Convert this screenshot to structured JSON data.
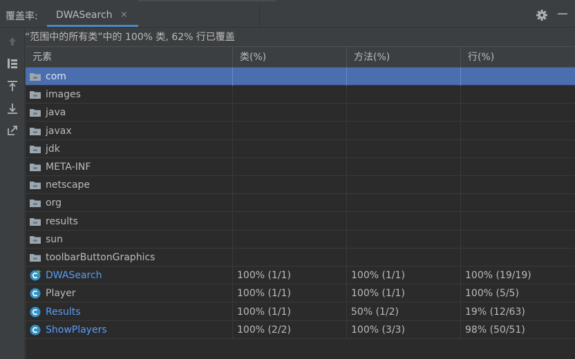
{
  "toolwindow": {
    "title": "覆盖率:",
    "tab_label": "DWASearch",
    "tab_close": "×",
    "settings_icon": "gear-icon",
    "hide_icon": "minimize-icon"
  },
  "toolbar": {
    "icons": [
      "arrow-up-icon",
      "flatten-packages-icon",
      "import-icon",
      "export-icon",
      "navigate-to-source-icon"
    ]
  },
  "summary": "“范围中的所有类”中的 100% 类, 62% 行已覆盖",
  "table": {
    "columns": [
      "元素",
      "类(%)",
      "方法(%)",
      "行(%)"
    ],
    "rows": [
      {
        "type": "package",
        "name": "com",
        "cls": "",
        "method": "",
        "line": "",
        "selected": true
      },
      {
        "type": "package",
        "name": "images",
        "cls": "",
        "method": "",
        "line": ""
      },
      {
        "type": "package",
        "name": "java",
        "cls": "",
        "method": "",
        "line": ""
      },
      {
        "type": "package",
        "name": "javax",
        "cls": "",
        "method": "",
        "line": ""
      },
      {
        "type": "package",
        "name": "jdk",
        "cls": "",
        "method": "",
        "line": ""
      },
      {
        "type": "package",
        "name": "META-INF",
        "cls": "",
        "method": "",
        "line": ""
      },
      {
        "type": "package",
        "name": "netscape",
        "cls": "",
        "method": "",
        "line": ""
      },
      {
        "type": "package",
        "name": "org",
        "cls": "",
        "method": "",
        "line": ""
      },
      {
        "type": "package",
        "name": "results",
        "cls": "",
        "method": "",
        "line": ""
      },
      {
        "type": "package",
        "name": "sun",
        "cls": "",
        "method": "",
        "line": ""
      },
      {
        "type": "package",
        "name": "toolbarButtonGraphics",
        "cls": "",
        "method": "",
        "line": ""
      },
      {
        "type": "class-main",
        "name": "DWASearch",
        "cls": "100% (1/1)",
        "method": "100% (1/1)",
        "line": "100% (19/19)",
        "link": true
      },
      {
        "type": "class",
        "name": "Player",
        "cls": "100% (1/1)",
        "method": "100% (1/1)",
        "line": "100% (5/5)",
        "link": false
      },
      {
        "type": "class",
        "name": "Results",
        "cls": "100% (1/1)",
        "method": "50% (1/2)",
        "line": "19% (12/63)",
        "link": true
      },
      {
        "type": "class",
        "name": "ShowPlayers",
        "cls": "100% (2/2)",
        "method": "100% (3/3)",
        "line": "98% (50/51)",
        "link": true
      }
    ]
  },
  "colors": {
    "selection": "#4b6eaf",
    "link": "#589df6",
    "folder": "#9aa7b0",
    "class_badge": "#3592c4",
    "run_badge": "#59a869"
  }
}
